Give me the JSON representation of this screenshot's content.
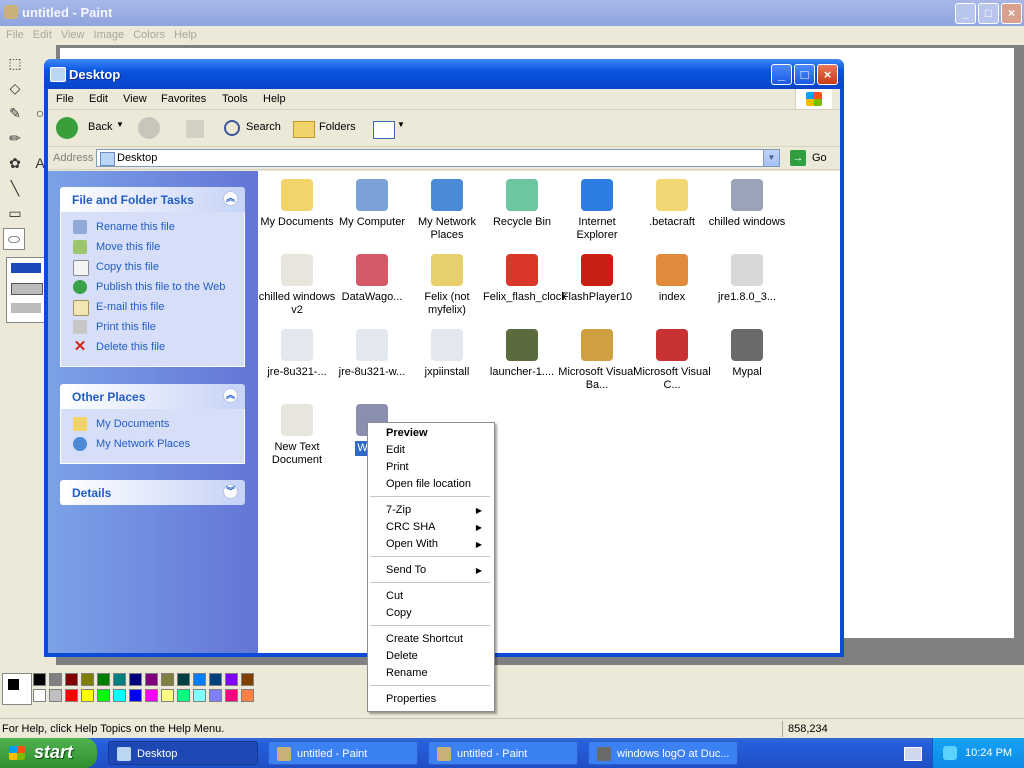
{
  "paint": {
    "title": "untitled - Paint",
    "menu": [
      "File",
      "Edit",
      "View",
      "Image",
      "Colors",
      "Help"
    ],
    "status_help": "For Help, click Help Topics on the Help Menu.",
    "status_coords": "858,234",
    "palette_colors": [
      "#000000",
      "#808080",
      "#800000",
      "#808000",
      "#008000",
      "#008080",
      "#000080",
      "#800080",
      "#808040",
      "#004040",
      "#0080ff",
      "#004080",
      "#8000ff",
      "#804000",
      "#ffffff",
      "#c0c0c0",
      "#ff0000",
      "#ffff00",
      "#00ff00",
      "#00ffff",
      "#0000ff",
      "#ff00ff",
      "#ffff80",
      "#00ff80",
      "#80ffff",
      "#8080ff",
      "#ff0080",
      "#ff8040"
    ]
  },
  "explorer": {
    "title": "Desktop",
    "menu": [
      "File",
      "Edit",
      "View",
      "Favorites",
      "Tools",
      "Help"
    ],
    "toolbar": {
      "back": "Back",
      "search": "Search",
      "folders": "Folders"
    },
    "address": {
      "label": "Address",
      "value": "Desktop",
      "go": "Go"
    },
    "file_tasks": {
      "header": "File and Folder Tasks",
      "items": [
        "Rename this file",
        "Move this file",
        "Copy this file",
        "Publish this file to the Web",
        "E-mail this file",
        "Print this file",
        "Delete this file"
      ]
    },
    "other_places": {
      "header": "Other Places",
      "items": [
        "My Documents",
        "My Network Places"
      ]
    },
    "details": {
      "header": "Details"
    },
    "files": [
      {
        "label": "My Documents",
        "icon": "my-documents-icon",
        "color": "#f2d46b"
      },
      {
        "label": "My Computer",
        "icon": "my-computer-icon",
        "color": "#7aa2d6"
      },
      {
        "label": "My Network Places",
        "icon": "network-places-icon",
        "color": "#4a8ad6"
      },
      {
        "label": "Recycle Bin",
        "icon": "recycle-bin-icon",
        "color": "#6cc6a0"
      },
      {
        "label": "Internet Explorer",
        "icon": "internet-explorer-icon",
        "color": "#2e7de0"
      },
      {
        "label": ".betacraft",
        "icon": "folder-icon",
        "color": "#f3d774"
      },
      {
        "label": "chilled windows",
        "icon": "program-window-icon",
        "color": "#9aa4b8"
      },
      {
        "label": "chilled windows v2",
        "icon": "text-file-icon",
        "color": "#e8e6dc"
      },
      {
        "label": "DataWago...",
        "icon": "datawago-icon",
        "color": "#d45a6a"
      },
      {
        "label": "Felix (not myfelix)",
        "icon": "zip-folder-icon",
        "color": "#e7cf6b"
      },
      {
        "label": "Felix_flash_clock",
        "icon": "swf-file-icon",
        "color": "#d9372b"
      },
      {
        "label": "FlashPlayer10",
        "icon": "flash-player-icon",
        "color": "#c81e14"
      },
      {
        "label": "index",
        "icon": "html-file-icon",
        "color": "#e08a3c"
      },
      {
        "label": "jre1.8.0_3...",
        "icon": "java-icon",
        "color": "#d8d8d8"
      },
      {
        "label": "jre-8u321-...",
        "icon": "java-installer-icon",
        "color": "#e3e7ef"
      },
      {
        "label": "jre-8u321-w...",
        "icon": "java-installer-icon",
        "color": "#e3e7ef"
      },
      {
        "label": "jxpiinstall",
        "icon": "java-installer-icon",
        "color": "#e3e7ef"
      },
      {
        "label": "launcher-1....",
        "icon": "betacraft-launcher-icon",
        "color": "#5a6b3e"
      },
      {
        "label": "Microsoft Visual Ba...",
        "icon": "visual-basic-icon",
        "color": "#d0a040"
      },
      {
        "label": "Microsoft Visual C...",
        "icon": "visual-c-icon",
        "color": "#c83232"
      },
      {
        "label": "Mypal",
        "icon": "mypal-raccoon-icon",
        "color": "#6a6a6a"
      },
      {
        "label": "New Text Document",
        "icon": "text-file-icon",
        "color": "#e8e6dc"
      },
      {
        "label": "WIND",
        "icon": "image-file-icon",
        "color": "#8a8fb0"
      }
    ]
  },
  "context_menu": {
    "items": [
      {
        "label": "Preview",
        "bold": true
      },
      {
        "label": "Edit"
      },
      {
        "label": "Print"
      },
      {
        "label": "Open file location"
      },
      {
        "label": "7-Zip",
        "submenu": true
      },
      {
        "label": "CRC SHA",
        "submenu": true
      },
      {
        "label": "Open With",
        "submenu": true
      },
      {
        "label": "Send To",
        "submenu": true
      },
      {
        "label": "Cut"
      },
      {
        "label": "Copy"
      },
      {
        "label": "Create Shortcut"
      },
      {
        "label": "Delete"
      },
      {
        "label": "Rename"
      },
      {
        "label": "Properties"
      }
    ]
  },
  "taskbar": {
    "start": "start",
    "tasks": [
      {
        "label": "Desktop",
        "active": true
      },
      {
        "label": "untitled - Paint",
        "active": false
      },
      {
        "label": "untitled - Paint",
        "active": false
      },
      {
        "label": "windows logO at Duc...",
        "active": false
      }
    ],
    "clock": "10:24 PM"
  }
}
